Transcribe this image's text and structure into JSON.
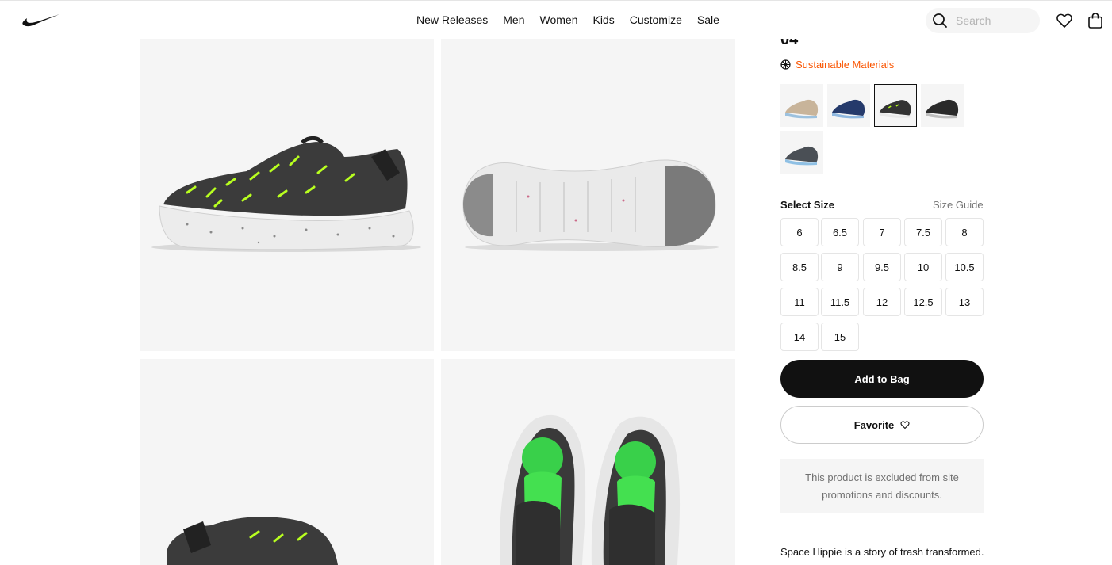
{
  "header": {
    "logo": "swoosh-logo",
    "nav": [
      "New Releases",
      "Men",
      "Women",
      "Kids",
      "Customize",
      "Sale"
    ],
    "search": {
      "placeholder": "Search",
      "icon": "search-icon"
    },
    "favorites_icon": "heart-icon",
    "bag_icon": "bag-icon"
  },
  "gallery": {
    "images": [
      "shoe-side-view",
      "shoe-sole-view",
      "shoe-heel-view",
      "shoe-top-pair-view"
    ]
  },
  "product": {
    "title_fragment": "04",
    "sustainable_label": "Sustainable Materials",
    "colorways": [
      {
        "name": "tan-blue",
        "selected": false
      },
      {
        "name": "navy-blue",
        "selected": false
      },
      {
        "name": "black-volt",
        "selected": true
      },
      {
        "name": "black-grey",
        "selected": false
      },
      {
        "name": "grey-blue",
        "selected": false
      }
    ],
    "select_size_label": "Select Size",
    "size_guide_label": "Size Guide",
    "sizes": [
      "6",
      "6.5",
      "7",
      "7.5",
      "8",
      "8.5",
      "9",
      "9.5",
      "10",
      "10.5",
      "11",
      "11.5",
      "12",
      "12.5",
      "13",
      "14",
      "15"
    ],
    "add_to_bag_label": "Add to Bag",
    "favorite_label": "Favorite",
    "promo_notice": "This product is excluded from site promotions and discounts.",
    "description_start": "Space Hippie is a story of trash transformed."
  },
  "colors": {
    "accent": "#fa5400",
    "primary": "#111111",
    "tile_bg": "#f5f5f5",
    "volt": "#c5f82a"
  }
}
